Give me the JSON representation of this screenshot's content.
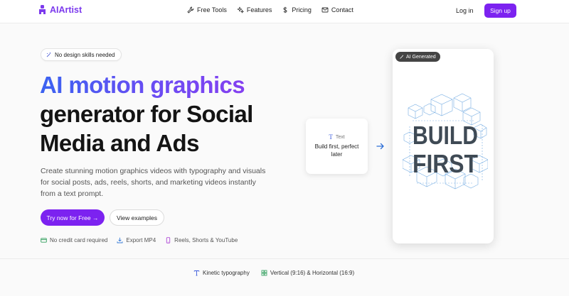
{
  "header": {
    "logo_text": "AIArtist",
    "nav": [
      {
        "label": "Free Tools",
        "icon": "wrench-icon"
      },
      {
        "label": "Features",
        "icon": "sparkles-icon"
      },
      {
        "label": "Pricing",
        "icon": "dollar-icon"
      },
      {
        "label": "Contact",
        "icon": "mail-icon"
      }
    ],
    "login_label": "Log in",
    "signup_label": "Sign up"
  },
  "hero": {
    "pill_label": "No design skills needed",
    "title_gradient": "AI motion graphics",
    "title_rest": "generator for Social Media and Ads",
    "description": "Create stunning motion graphics videos with typography and visuals for social posts, ads, reels, shorts, and marketing videos instantly from a text prompt.",
    "primary_cta": "Try now for Free →",
    "secondary_cta": "View examples",
    "features": [
      {
        "label": "No credit card required",
        "icon": "credit-card-icon"
      },
      {
        "label": "Export MP4",
        "icon": "download-icon"
      },
      {
        "label": "Reels, Shorts & YouTube",
        "icon": "phone-icon"
      }
    ]
  },
  "preview": {
    "text_card_heading": "Text",
    "text_card_body": "Build first, perfect later",
    "badge_label": "AI Generated",
    "art_word_1": "BUILD",
    "art_word_2": "FIRST"
  },
  "bottom_features": [
    {
      "label": "Kinetic typography",
      "icon": "type-icon"
    },
    {
      "label": "Vertical (9:16) & Horizontal (16:9)",
      "icon": "grid-icon"
    }
  ],
  "colors": {
    "brand": "#7c22f0",
    "gradient_start": "#3b63f1",
    "gradient_end": "#8b3df0",
    "art_lines": "#4a8fd0"
  }
}
